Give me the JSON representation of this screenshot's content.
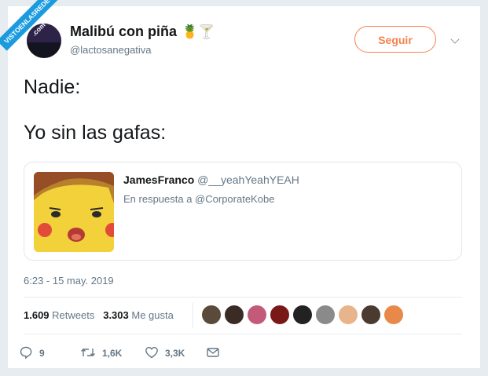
{
  "watermark": {
    "text": "VISTOENLASREDES .com"
  },
  "user": {
    "name": "Malibú con piña",
    "emoji": "🍍🍸",
    "handle": "@lactosanegativa"
  },
  "follow_label": "Seguir",
  "tweet": {
    "line1": "Nadie:",
    "line2": "Yo sin las gafas:"
  },
  "quoted": {
    "name": "JamesFranco",
    "handle": "@__yeahYeahYEAH",
    "reply": "En respuesta a @CorporateKobe"
  },
  "timestamp": "6:23 - 15 may. 2019",
  "stats": {
    "retweets_count": "1.609",
    "retweets_label": "Retweets",
    "likes_count": "3.303",
    "likes_label": "Me gusta"
  },
  "likers_colors": [
    "#5a4a3a",
    "#3a2c25",
    "#c45a7a",
    "#7a1818",
    "#222222",
    "#8a8a8a",
    "#e8b48c",
    "#4a3a30",
    "#e8894a"
  ],
  "actions": {
    "replies": "9",
    "retweets": "1,6K",
    "likes": "3,3K"
  },
  "colors": {
    "accent": "#f4824c",
    "secondary_text": "#657786",
    "watermark": "#1a9be0"
  },
  "icons": [
    "chevron-down-icon",
    "reply-icon",
    "retweet-icon",
    "like-icon",
    "message-icon"
  ]
}
